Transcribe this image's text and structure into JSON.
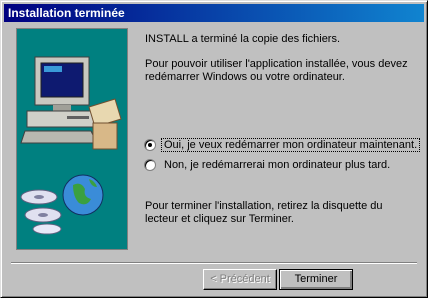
{
  "window": {
    "title": "Installation terminée"
  },
  "messages": {
    "copied": "INSTALL a terminé la copie des fichiers.",
    "restart_notice": "Pour pouvoir utiliser l'application installée, vous devez redémarrer Windows ou votre ordinateur.",
    "finish_instructions": "Pour terminer l'installation, retirez la disquette du lecteur et cliquez sur Terminer."
  },
  "options": {
    "restart_now": "Oui, je veux redémarrer mon ordinateur maintenant.",
    "restart_later": "Non, je redémarrerai mon ordinateur plus tard.",
    "selected": "restart_now"
  },
  "buttons": {
    "back": "< Précédent",
    "finish": "Terminer"
  },
  "icons": {
    "illustration": "computer-with-globe-and-disks"
  },
  "colors": {
    "titlebar_start": "#000080",
    "titlebar_end": "#1084d0",
    "illustration_bg": "#008080",
    "dialog_bg": "#c0c0c0"
  }
}
